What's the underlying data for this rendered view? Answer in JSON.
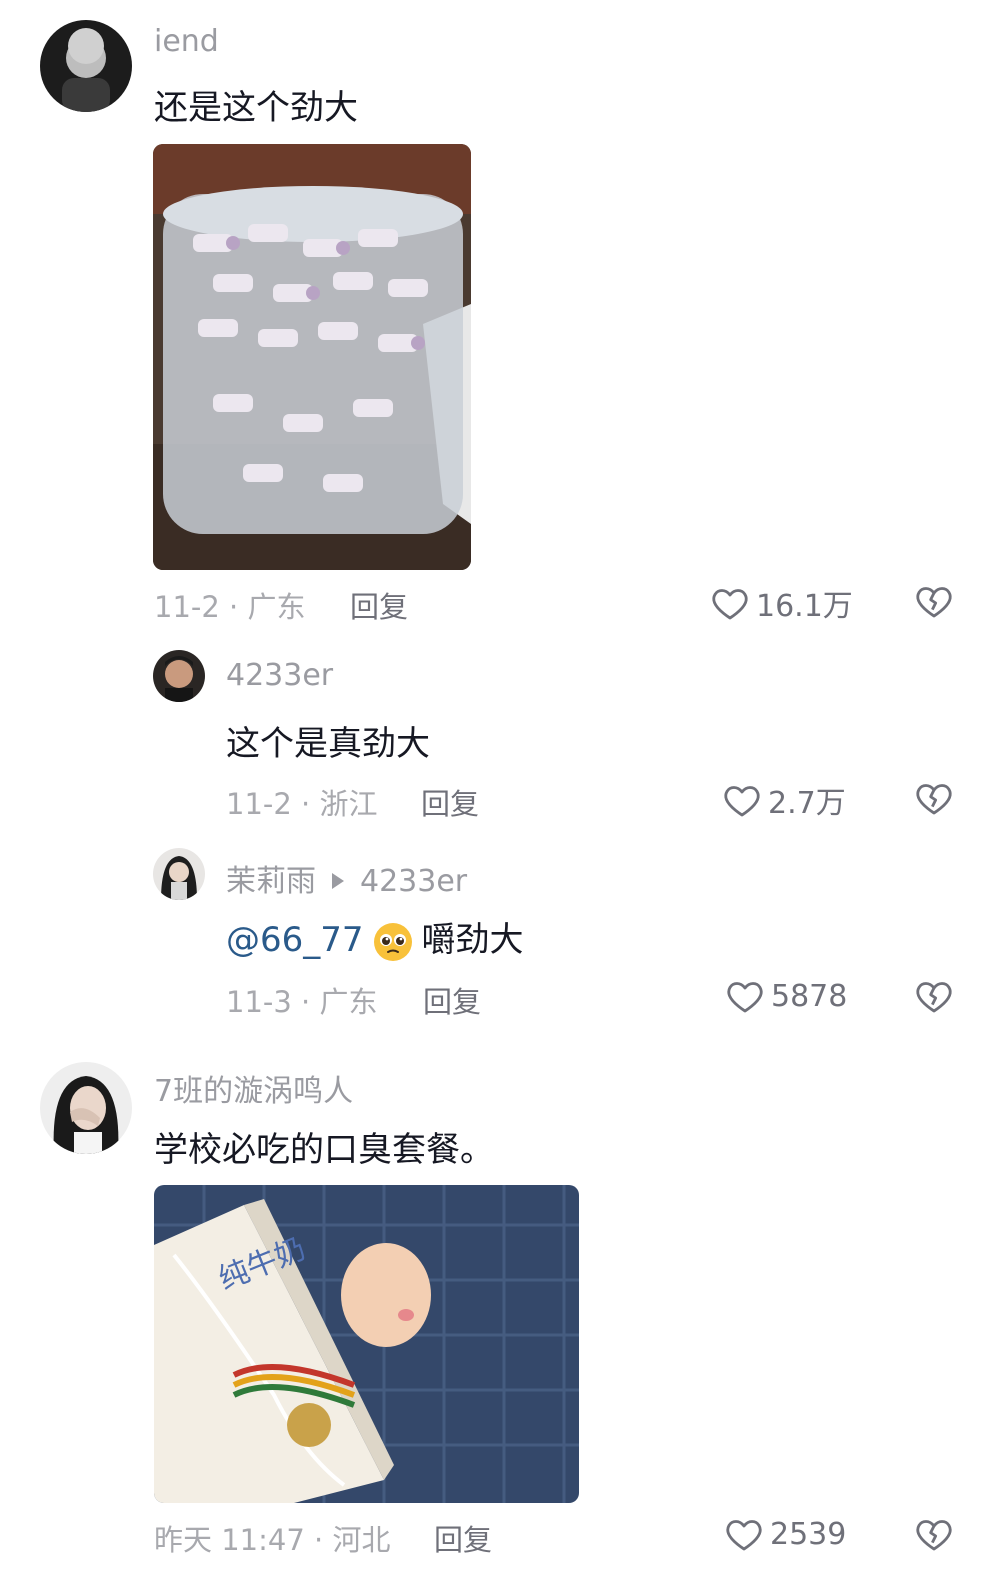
{
  "comments": [
    {
      "username": "iend",
      "text": "还是这个劲大",
      "date_location": "11-2 · 广东",
      "reply_label": "回复",
      "likes": "16.1万"
    },
    {
      "username": "4233er",
      "text": "这个是真劲大",
      "date_location": "11-2 · 浙江",
      "reply_label": "回复",
      "likes": "2.7万"
    },
    {
      "username": "茉莉雨",
      "reply_to": "4233er",
      "mention": "@66_77",
      "text": "嚼劲大",
      "emoji": "pleading-face-emoji",
      "date_location": "11-3 · 广东",
      "reply_label": "回复",
      "likes": "5878"
    },
    {
      "username": "7班的漩涡鸣人",
      "text": "学校必吃的口臭套餐。",
      "date_location": "昨天 11:47 · 河北",
      "reply_label": "回复",
      "likes": "2539"
    }
  ],
  "icons": {
    "like": "heart-outline-icon",
    "dislike": "broken-heart-icon"
  },
  "colors": {
    "text": "#161823",
    "muted": "#a8a9ae",
    "username": "#9a9ba1",
    "mention": "#2a5a8a"
  }
}
